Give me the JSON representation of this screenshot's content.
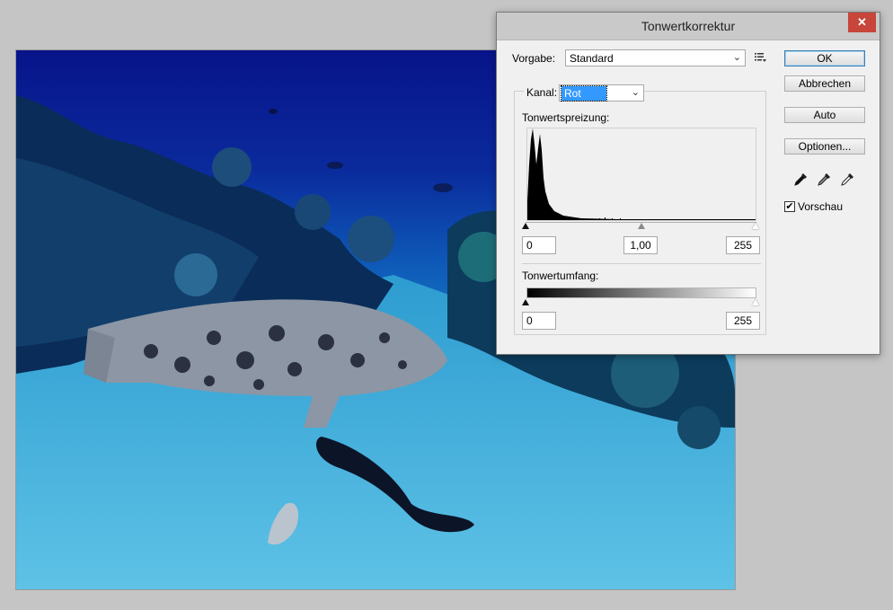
{
  "dialog": {
    "title": "Tonwertkorrektur",
    "close_glyph": "✕"
  },
  "preset": {
    "label": "Vorgabe:",
    "value": "Standard",
    "menu_icon": "preset-options-icon"
  },
  "channel": {
    "label": "Kanal:",
    "value": "Rot"
  },
  "input_levels": {
    "label": "Tonwertspreizung:",
    "black": "0",
    "gamma": "1,00",
    "white": "255"
  },
  "output_levels": {
    "label": "Tonwertumfang:",
    "black": "0",
    "white": "255"
  },
  "buttons": {
    "ok": "OK",
    "cancel": "Abbrechen",
    "auto": "Auto",
    "options": "Optionen..."
  },
  "eyedroppers": [
    "black-point-eyedropper-icon",
    "gray-point-eyedropper-icon",
    "white-point-eyedropper-icon"
  ],
  "preview": {
    "label": "Vorschau",
    "checked": true,
    "check_glyph": "✔"
  },
  "colors": {
    "selection": "#3399ff",
    "close_button": "#c7453a",
    "desktop": "#c5c5c5"
  }
}
